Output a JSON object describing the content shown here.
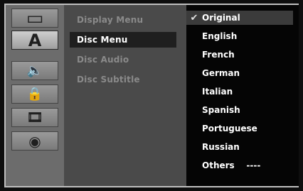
{
  "side_icons": [
    {
      "name": "display-icon",
      "glyph": "▭"
    },
    {
      "name": "language-icon",
      "glyph": "A"
    },
    {
      "name": "audio-icon",
      "glyph": "🔈"
    },
    {
      "name": "lock-icon",
      "glyph": "🔒"
    },
    {
      "name": "film-icon",
      "glyph": "🎞"
    },
    {
      "name": "disc-icon",
      "glyph": "◉"
    }
  ],
  "menu": {
    "items": [
      {
        "label": "Display Menu"
      },
      {
        "label": "Disc Menu"
      },
      {
        "label": "Disc Audio"
      },
      {
        "label": "Disc Subtitle"
      }
    ]
  },
  "options": {
    "checkmark": "✔",
    "items": [
      {
        "label": "Original"
      },
      {
        "label": "English"
      },
      {
        "label": "French"
      },
      {
        "label": "German"
      },
      {
        "label": "Italian"
      },
      {
        "label": "Spanish"
      },
      {
        "label": "Portuguese"
      },
      {
        "label": "Russian"
      },
      {
        "label": "Others    ----"
      }
    ]
  },
  "colors": {
    "frame": "#bfbfbf",
    "icon_column": "#6c6c6c",
    "menu_column": "#4a4a4a",
    "options_column": "#050505",
    "highlight": "#1f1f1f"
  }
}
